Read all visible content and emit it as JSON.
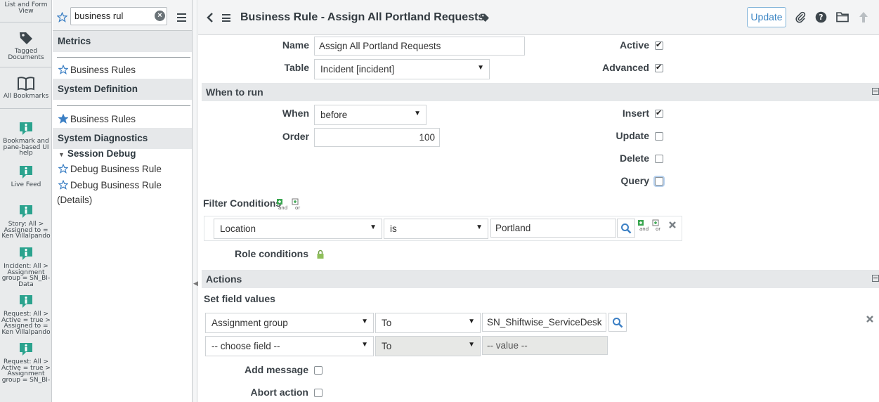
{
  "rail": {
    "items": [
      {
        "label": "List and Form View",
        "icon": "form-view-icon"
      },
      {
        "label": "Tagged Documents",
        "icon": "tag-icon"
      },
      {
        "label": "All Bookmarks",
        "icon": "book-icon"
      },
      {
        "label": "Bookmark and pane-based UI help",
        "icon": "help-bookmark-icon"
      },
      {
        "label": "Live Feed",
        "icon": "help-bookmark-icon"
      },
      {
        "label": "Story: All > Assigned to = Ken Villalpando",
        "icon": "help-bookmark-icon"
      },
      {
        "label": "Incident: All > Assignment group = SN_BI-Data",
        "icon": "help-bookmark-icon"
      },
      {
        "label": "Request: All > Active = true > Assigned to = Ken Villalpando",
        "icon": "help-bookmark-icon"
      },
      {
        "label": "Request: All > Active = true > Assignment group = SN_BI-",
        "icon": "help-bookmark-icon"
      }
    ]
  },
  "nav": {
    "search_value": "business rul",
    "sections": [
      {
        "title": "Metrics"
      },
      {
        "title": "System Definition"
      },
      {
        "title": "System Diagnostics"
      }
    ],
    "modules": {
      "metrics_business_rules": "Business Rules",
      "sysdef_business_rules": "Business Rules",
      "session_debug": "Session Debug",
      "debug_business_rule": "Debug Business Rule",
      "debug_business_rule_details_1": "Debug Business Rule",
      "debug_business_rule_details_2": "(Details)"
    }
  },
  "header": {
    "title": "Business Rule - Assign All Portland Requests",
    "update_label": "Update"
  },
  "form": {
    "name_label": "Name",
    "name_value": "Assign All Portland Requests",
    "table_label": "Table",
    "table_value": "Incident [incident]",
    "active_label": "Active",
    "active": true,
    "advanced_label": "Advanced",
    "advanced": true,
    "when_to_run_title": "When to run",
    "when_label": "When",
    "when_value": "before",
    "order_label": "Order",
    "order_value": "100",
    "insert_label": "Insert",
    "insert": true,
    "update_label": "Update",
    "update": false,
    "delete_label": "Delete",
    "delete": false,
    "query_label": "Query",
    "query": false,
    "filter_label": "Filter Conditions",
    "and_label": "and",
    "or_label": "or",
    "condition": {
      "field": "Location",
      "operator": "is",
      "value": "Portland"
    },
    "role_conditions_label": "Role conditions",
    "actions_title": "Actions",
    "set_field_values_label": "Set field values",
    "set_rows": [
      {
        "field": "Assignment group",
        "op": "To",
        "value": "SN_Shiftwise_ServiceDesk"
      },
      {
        "field": "-- choose field --",
        "op": "To",
        "value": "-- value --"
      }
    ],
    "add_message_label": "Add message",
    "abort_action_label": "Abort action"
  },
  "colors": {
    "accent": "#3b85c4",
    "bookmark_icon": "#2ba38e",
    "star": "#3b7fc4"
  }
}
